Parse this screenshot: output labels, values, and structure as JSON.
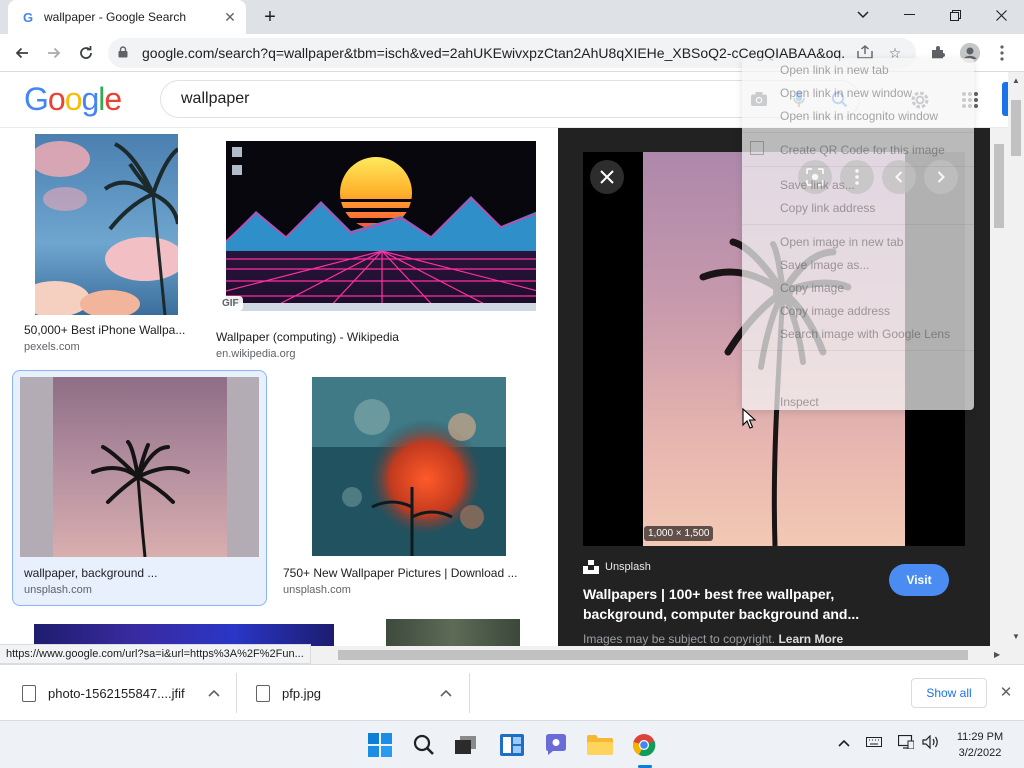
{
  "browser": {
    "tab_title": "wallpaper - Google Search",
    "tab_favicon": "G",
    "url": "google.com/search?q=wallpaper&tbm=isch&ved=2ahUKEwivxpzCtan2AhU8qXIEHe_XBSoQ2-cCegQIABAA&oq...",
    "status_url": "https://www.google.com/url?sa=i&url=https%3A%2F%2Fun..."
  },
  "google": {
    "logo_letters": [
      "G",
      "o",
      "o",
      "g",
      "l",
      "e"
    ],
    "logo_colors": [
      "#4285f4",
      "#ea4335",
      "#fbbc05",
      "#4285f4",
      "#34a853",
      "#ea4335"
    ],
    "query": "wallpaper"
  },
  "results": [
    {
      "title": "50,000+ Best iPhone Wallpa...",
      "source": "pexels.com"
    },
    {
      "title": "Wallpaper (computing) - Wikipedia",
      "source": "en.wikipedia.org",
      "badge": "GIF"
    },
    {
      "title": "wallpaper, background ...",
      "source": "unsplash.com"
    },
    {
      "title": "750+ New Wallpaper Pictures | Download ...",
      "source": "unsplash.com"
    }
  ],
  "preview": {
    "dimensions": "1,000 × 1,500",
    "source_name": "Unsplash",
    "title": "Wallpapers | 100+ best free wallpaper, background, computer background and...",
    "visit_label": "Visit",
    "copyright_text": "Images may be subject to copyright.",
    "learn_more": "Learn More"
  },
  "context_menu": {
    "items": [
      "Open link in new tab",
      "Open link in new window",
      "Open link in incognito window",
      "Create QR Code for this image",
      "Save link as...",
      "Copy link address",
      "Open image in new tab",
      "Save image as...",
      "Copy image",
      "Copy image address",
      "Search image with Google Lens",
      "Inspect"
    ]
  },
  "downloads": {
    "items": [
      {
        "name": "photo-1562155847....jfif"
      },
      {
        "name": "pfp.jpg"
      }
    ],
    "show_all": "Show all"
  },
  "taskbar": {
    "time": "11:29 PM",
    "date": "3/2/2022"
  }
}
